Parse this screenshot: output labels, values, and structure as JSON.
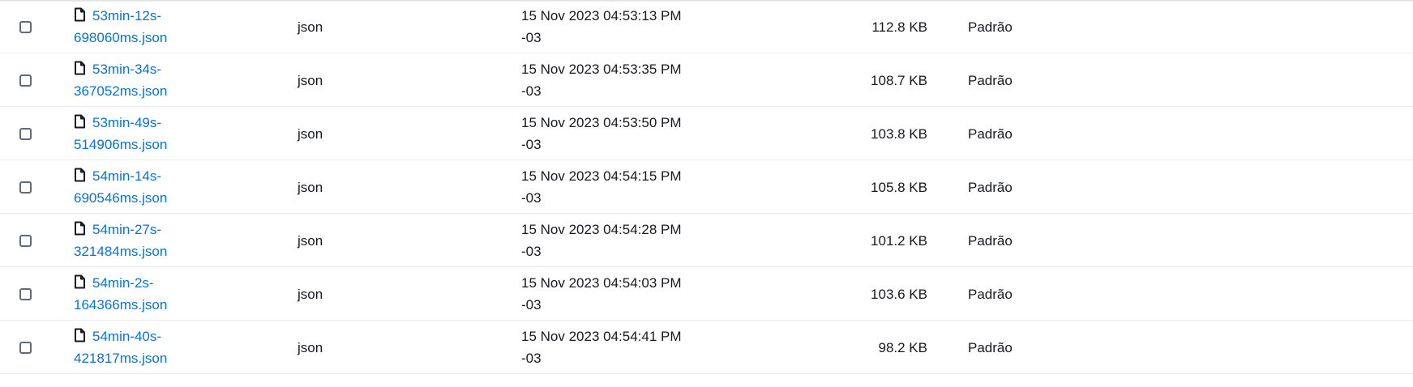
{
  "rows": [
    {
      "name_line1": "53min-12s-",
      "name_line2": "698060ms.json",
      "type": "json",
      "modified_line1": "15 Nov 2023 04:53:13 PM",
      "modified_line2": "-03",
      "size": "112.8 KB",
      "storage_class": "Padrão"
    },
    {
      "name_line1": "53min-34s-",
      "name_line2": "367052ms.json",
      "type": "json",
      "modified_line1": "15 Nov 2023 04:53:35 PM",
      "modified_line2": "-03",
      "size": "108.7 KB",
      "storage_class": "Padrão"
    },
    {
      "name_line1": "53min-49s-",
      "name_line2": "514906ms.json",
      "type": "json",
      "modified_line1": "15 Nov 2023 04:53:50 PM",
      "modified_line2": "-03",
      "size": "103.8 KB",
      "storage_class": "Padrão"
    },
    {
      "name_line1": "54min-14s-",
      "name_line2": "690546ms.json",
      "type": "json",
      "modified_line1": "15 Nov 2023 04:54:15 PM",
      "modified_line2": "-03",
      "size": "105.8 KB",
      "storage_class": "Padrão"
    },
    {
      "name_line1": "54min-27s-",
      "name_line2": "321484ms.json",
      "type": "json",
      "modified_line1": "15 Nov 2023 04:54:28 PM",
      "modified_line2": "-03",
      "size": "101.2 KB",
      "storage_class": "Padrão"
    },
    {
      "name_line1": "54min-2s-",
      "name_line2": "164366ms.json",
      "type": "json",
      "modified_line1": "15 Nov 2023 04:54:03 PM",
      "modified_line2": "-03",
      "size": "103.6 KB",
      "storage_class": "Padrão"
    },
    {
      "name_line1": "54min-40s-",
      "name_line2": "421817ms.json",
      "type": "json",
      "modified_line1": "15 Nov 2023 04:54:41 PM",
      "modified_line2": "-03",
      "size": "98.2 KB",
      "storage_class": "Padrão"
    }
  ],
  "icons": {
    "file": "file-icon",
    "checkbox": "checkbox"
  },
  "colors": {
    "link": "#0972d3",
    "text": "#16191f",
    "divider": "#e9ebed",
    "checkbox_border": "#5f6b7a"
  }
}
